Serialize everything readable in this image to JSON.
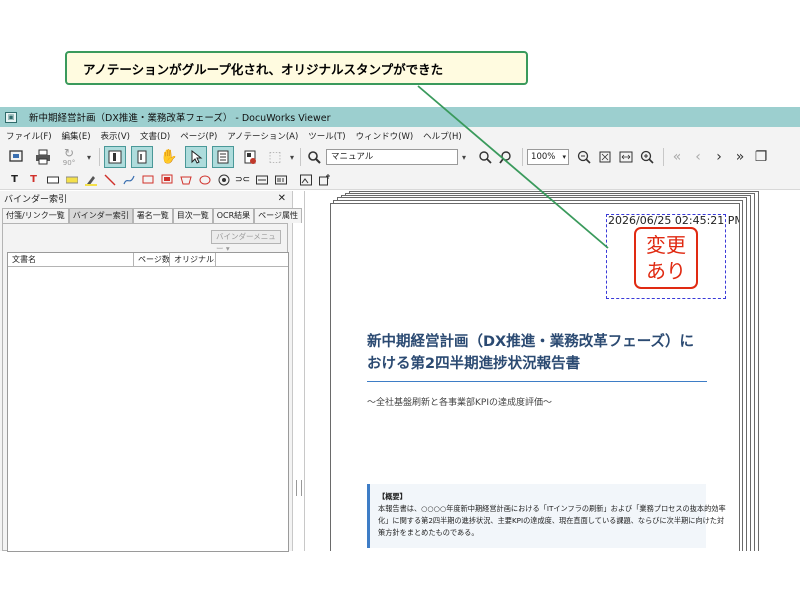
{
  "callout": {
    "text": "アノテーションがグループ化され、オリジナルスタンプができた"
  },
  "window": {
    "title": "新中期経営計画（DX推進・業務改革フェーズ） - DocuWorks Viewer"
  },
  "menu": [
    "ファイル(F)",
    "編集(E)",
    "表示(V)",
    "文書(D)",
    "ページ(P)",
    "アノテーション(A)",
    "ツール(T)",
    "ウィンドウ(W)",
    "ヘルプ(H)"
  ],
  "toolbar": {
    "search_value": "マニュアル",
    "zoom_value": "100%",
    "rotate_label": "90°"
  },
  "left_panel": {
    "title": "バインダー索引",
    "tabs": [
      "付箋/リンク一覧",
      "バインダー索引",
      "署名一覧",
      "目次一覧",
      "OCR結果",
      "ページ属性"
    ],
    "binder_menu": "バインダーメニュー",
    "columns": [
      "文書名",
      "ページ数",
      "オリジナル..."
    ]
  },
  "document": {
    "timestamp": "2026/06/25 02:45:21 PM",
    "stamp_line1": "変更",
    "stamp_line2": "あり",
    "title_line1": "新中期経営計画（DX推進・業務改革フェーズ）に",
    "title_line2": "おける第2四半期進捗状況報告書",
    "subtitle": "〜全社基盤刷新と各事業部KPIの達成度評価〜",
    "summary_label": "【概要】",
    "summary_line1": "本報告書は、○○○○年度新中期経営計画における「ITインフラの刷新」および「業務プロセスの抜本的効率",
    "summary_line2": "化」に関する第2四半期の進捗状況、主要KPIの達成度、現在直面している課題、ならびに次半期に向けた対",
    "summary_line3": "策方針をまとめたものである。"
  },
  "colors": {
    "titlebar": "#9ccfcf",
    "callout_border": "#3a9a5c",
    "callout_bg": "#fffbe0",
    "stamp": "#e02a12",
    "heading": "#2b4a72",
    "accent": "#3e7dc6"
  }
}
